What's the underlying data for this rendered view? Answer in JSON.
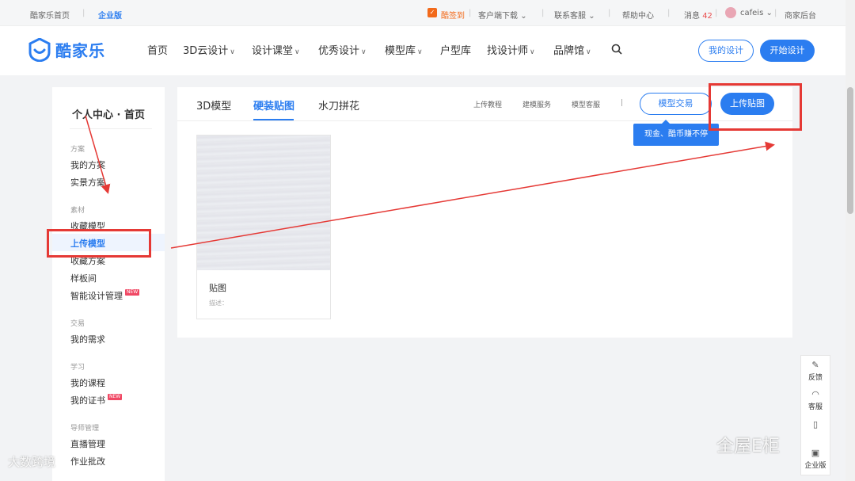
{
  "topbar": {
    "home": "酷家乐首页",
    "enterprise": "企业版",
    "sign": "酷签到",
    "client_download": "客户端下载",
    "contact_service": "联系客服",
    "help_center": "帮助中心",
    "messages_label": "消息",
    "messages_count": "42",
    "username": "cafeis",
    "merchant": "商家后台"
  },
  "header": {
    "logo_text": "酷家乐",
    "nav": [
      "首页",
      "3D云设计",
      "设计课堂",
      "优秀设计",
      "模型库",
      "户型库",
      "找设计师",
      "品牌馆"
    ],
    "my_design": "我的设计",
    "start_design": "开始设计"
  },
  "sidebar": {
    "title": "个人中心 · 首页",
    "groups": {
      "plan": "方案",
      "material": "素材",
      "trade": "交易",
      "study": "学习",
      "mentor": "导师管理"
    },
    "items": {
      "my_plans": "我的方案",
      "real_plans": "实景方案",
      "fav_models": "收藏模型",
      "upload_model": "上传模型",
      "fav_plans": "收藏方案",
      "showroom": "样板间",
      "smart_design": "智能设计管理",
      "my_needs": "我的需求",
      "my_courses": "我的课程",
      "my_certs": "我的证书",
      "live_manage": "直播管理",
      "homework": "作业批改"
    },
    "new_badge": "NEW"
  },
  "main": {
    "tabs": [
      "3D模型",
      "硬装贴图",
      "水刀拼花"
    ],
    "links": [
      "上传教程",
      "建模服务",
      "模型客服"
    ],
    "model_trade": "模型交易",
    "upload_texture": "上传贴图",
    "tip": "现金、酷币赚不停",
    "card": {
      "title": "贴图",
      "desc": "描述："
    }
  },
  "float_tools": {
    "feedback": "反馈",
    "service": "客服",
    "enterprise": "企业版"
  },
  "watermarks": {
    "left": "大数跨境",
    "right": "全屋E柜"
  }
}
